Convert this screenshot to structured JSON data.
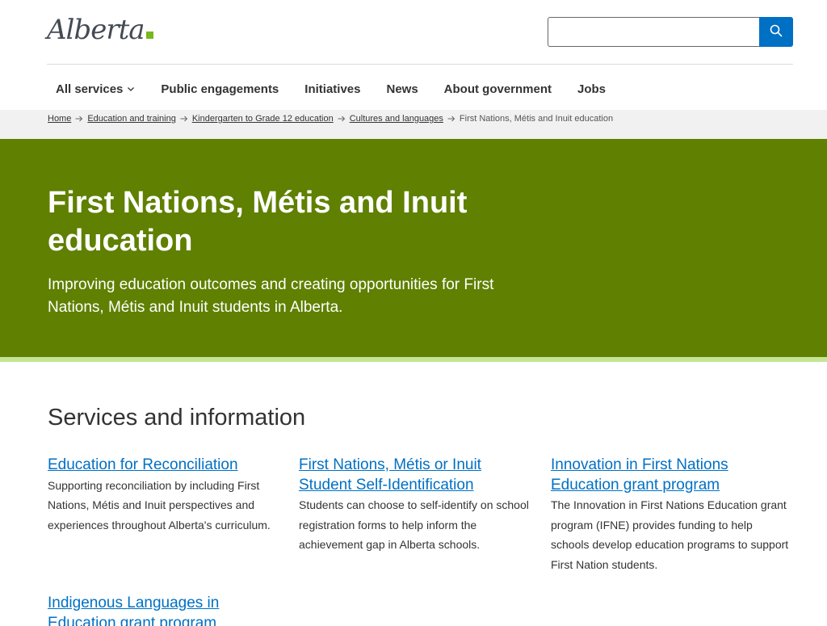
{
  "header": {
    "logo_text": "Alberta",
    "search": {
      "value": "",
      "placeholder": ""
    },
    "search_button_icon": "search-icon"
  },
  "nav": {
    "items": [
      {
        "label": "All services",
        "has_dropdown": true
      },
      {
        "label": "Public engagements"
      },
      {
        "label": "Initiatives"
      },
      {
        "label": "News"
      },
      {
        "label": "About government"
      },
      {
        "label": "Jobs"
      }
    ]
  },
  "breadcrumb": {
    "links": [
      "Home",
      "Education and training",
      "Kindergarten to Grade 12 education",
      "Cultures and languages"
    ],
    "current": "First Nations, Métis and Inuit education"
  },
  "hero": {
    "title": "First Nations, Métis and Inuit education",
    "lead": "Improving education outcomes and creating opportunities for First Nations, Métis and Inuit students in Alberta."
  },
  "services": {
    "title": "Services and information",
    "cards": [
      {
        "link": "Education for Reconciliation",
        "desc": "Supporting reconciliation by including First Nations, Métis and Inuit perspectives and experiences throughout Alberta's curriculum."
      },
      {
        "link": "First Nations, Métis or Inuit Student Self-Identification",
        "desc": "Students can choose to self-identify on school registration forms to help inform the achievement gap in Alberta schools."
      },
      {
        "link": "Innovation in First Nations Education grant program",
        "desc": "The Innovation in First Nations Education grant program (IFNE) provides funding to help schools develop education programs to support First Nation students."
      },
      {
        "link": "Indigenous Languages in Education grant program",
        "desc": ""
      }
    ]
  },
  "colors": {
    "hero_bg": "#5f8000",
    "hero_accent": "#c5e596",
    "link": "#0070c4",
    "logo_mark": "#77b81e"
  }
}
